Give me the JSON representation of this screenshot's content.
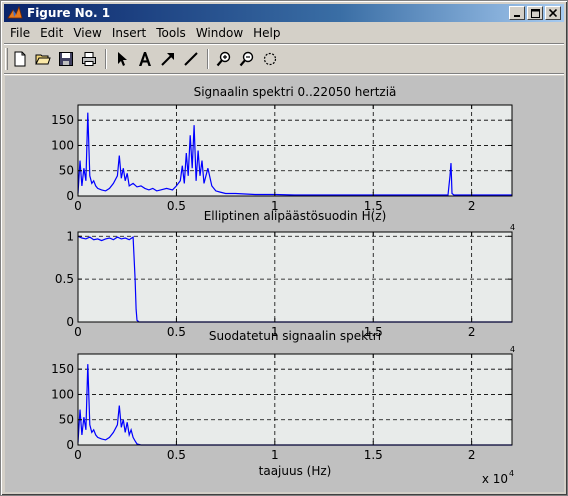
{
  "window": {
    "title": "Figure No. 1",
    "accent": "#0a246a"
  },
  "menu": [
    "File",
    "Edit",
    "View",
    "Insert",
    "Tools",
    "Window",
    "Help"
  ],
  "toolbar": {
    "icons": [
      "new-file-icon",
      "open-file-icon",
      "save-icon",
      "print-icon",
      "arrow-select-icon",
      "insert-text-icon",
      "insert-arrow-icon",
      "insert-line-icon",
      "zoom-in-icon",
      "zoom-out-icon",
      "rotate-icon"
    ]
  },
  "chart_data": [
    {
      "type": "line",
      "title": "Signaalin spektri 0..22050 hertziä",
      "xlim": [
        0,
        22050
      ],
      "ylim": [
        0,
        180
      ],
      "yticks": [
        0,
        50,
        100,
        150
      ],
      "ytick_labels": [
        "0",
        "50",
        "100",
        "150"
      ],
      "xticks": [
        0,
        5000,
        10000,
        15000,
        20000
      ],
      "xtick_labels": [
        "0",
        "0.5",
        "1",
        "1.5",
        "2"
      ],
      "grid": true,
      "color": "#0000ff",
      "series": [
        {
          "x": [
            0,
            100,
            200,
            300,
            400,
            500,
            600,
            700,
            800,
            900,
            1000,
            1200,
            1400,
            1600,
            1800,
            2000,
            2100,
            2200,
            2300,
            2400,
            2500,
            2600,
            2800,
            3000,
            3200,
            3400,
            3600,
            3800,
            4000,
            4200,
            4500,
            4800,
            5000,
            5200,
            5300,
            5400,
            5500,
            5600,
            5700,
            5800,
            5900,
            6000,
            6100,
            6200,
            6300,
            6400,
            6600,
            6800,
            7000,
            7200,
            7500,
            8000,
            9000,
            10000,
            11000,
            12000,
            13000,
            14000,
            15000,
            16000,
            17000,
            18000,
            18800,
            18900,
            18950,
            19000,
            19100,
            20000,
            21000,
            22050
          ],
          "y": [
            5,
            70,
            20,
            55,
            30,
            165,
            40,
            25,
            30,
            20,
            15,
            12,
            10,
            15,
            25,
            40,
            80,
            35,
            55,
            30,
            45,
            20,
            25,
            18,
            20,
            15,
            12,
            15,
            10,
            12,
            15,
            12,
            20,
            30,
            60,
            25,
            85,
            40,
            120,
            55,
            140,
            30,
            90,
            40,
            70,
            25,
            55,
            20,
            10,
            8,
            5,
            5,
            3,
            3,
            2,
            2,
            2,
            2,
            2,
            2,
            2,
            2,
            2,
            40,
            65,
            5,
            2,
            2,
            2,
            2
          ]
        }
      ]
    },
    {
      "type": "line",
      "title": "Elliptinen alipäästösuodin H(z)",
      "xlim": [
        0,
        22050
      ],
      "ylim": [
        0,
        1.05
      ],
      "yticks": [
        0,
        0.5,
        1
      ],
      "ytick_labels": [
        "0",
        "0.5",
        "1"
      ],
      "xticks": [
        0,
        5000,
        10000,
        15000,
        20000
      ],
      "xtick_labels": [
        "0",
        "0.5",
        "1",
        "1.5",
        "2"
      ],
      "grid": true,
      "color": "#0000ff",
      "exponent_label": "4",
      "series": [
        {
          "x": [
            0,
            200,
            400,
            600,
            800,
            1000,
            1200,
            1400,
            1600,
            1800,
            2000,
            2200,
            2400,
            2600,
            2800,
            2900,
            2950,
            3000,
            3050,
            3100,
            3200,
            4000,
            8000,
            12000,
            16000,
            20000,
            22050
          ],
          "y": [
            1.0,
            0.98,
            0.97,
            0.99,
            0.96,
            0.97,
            0.95,
            0.97,
            0.98,
            0.96,
            0.99,
            0.97,
            0.98,
            0.96,
            0.99,
            0.5,
            0.15,
            0.02,
            0.01,
            0.0,
            0.0,
            0.0,
            0.0,
            0.0,
            0.0,
            0.0,
            0.0
          ]
        }
      ]
    },
    {
      "type": "line",
      "title": "Suodatetun signaalin spektri",
      "xlim": [
        0,
        22050
      ],
      "ylim": [
        0,
        180
      ],
      "yticks": [
        0,
        50,
        100,
        150
      ],
      "ytick_labels": [
        "0",
        "50",
        "100",
        "150"
      ],
      "xticks": [
        0,
        5000,
        10000,
        15000,
        20000
      ],
      "xtick_labels": [
        "0",
        "0.5",
        "1",
        "1.5",
        "2"
      ],
      "xlabel": "taajuus (Hz)",
      "grid": true,
      "color": "#0000ff",
      "exponent_label": "4",
      "scale_label": "x 10",
      "scale_exponent": "4",
      "series": [
        {
          "x": [
            0,
            100,
            200,
            300,
            400,
            500,
            600,
            700,
            800,
            900,
            1000,
            1200,
            1400,
            1600,
            1800,
            2000,
            2100,
            2200,
            2300,
            2400,
            2500,
            2600,
            2700,
            2800,
            2900,
            3000,
            3200,
            4000,
            8000,
            12000,
            16000,
            20000,
            22050
          ],
          "y": [
            5,
            70,
            20,
            55,
            30,
            160,
            40,
            25,
            30,
            20,
            15,
            12,
            10,
            15,
            25,
            40,
            78,
            35,
            50,
            25,
            45,
            20,
            30,
            15,
            8,
            2,
            0,
            0,
            0,
            0,
            0,
            0,
            0
          ]
        }
      ]
    }
  ]
}
